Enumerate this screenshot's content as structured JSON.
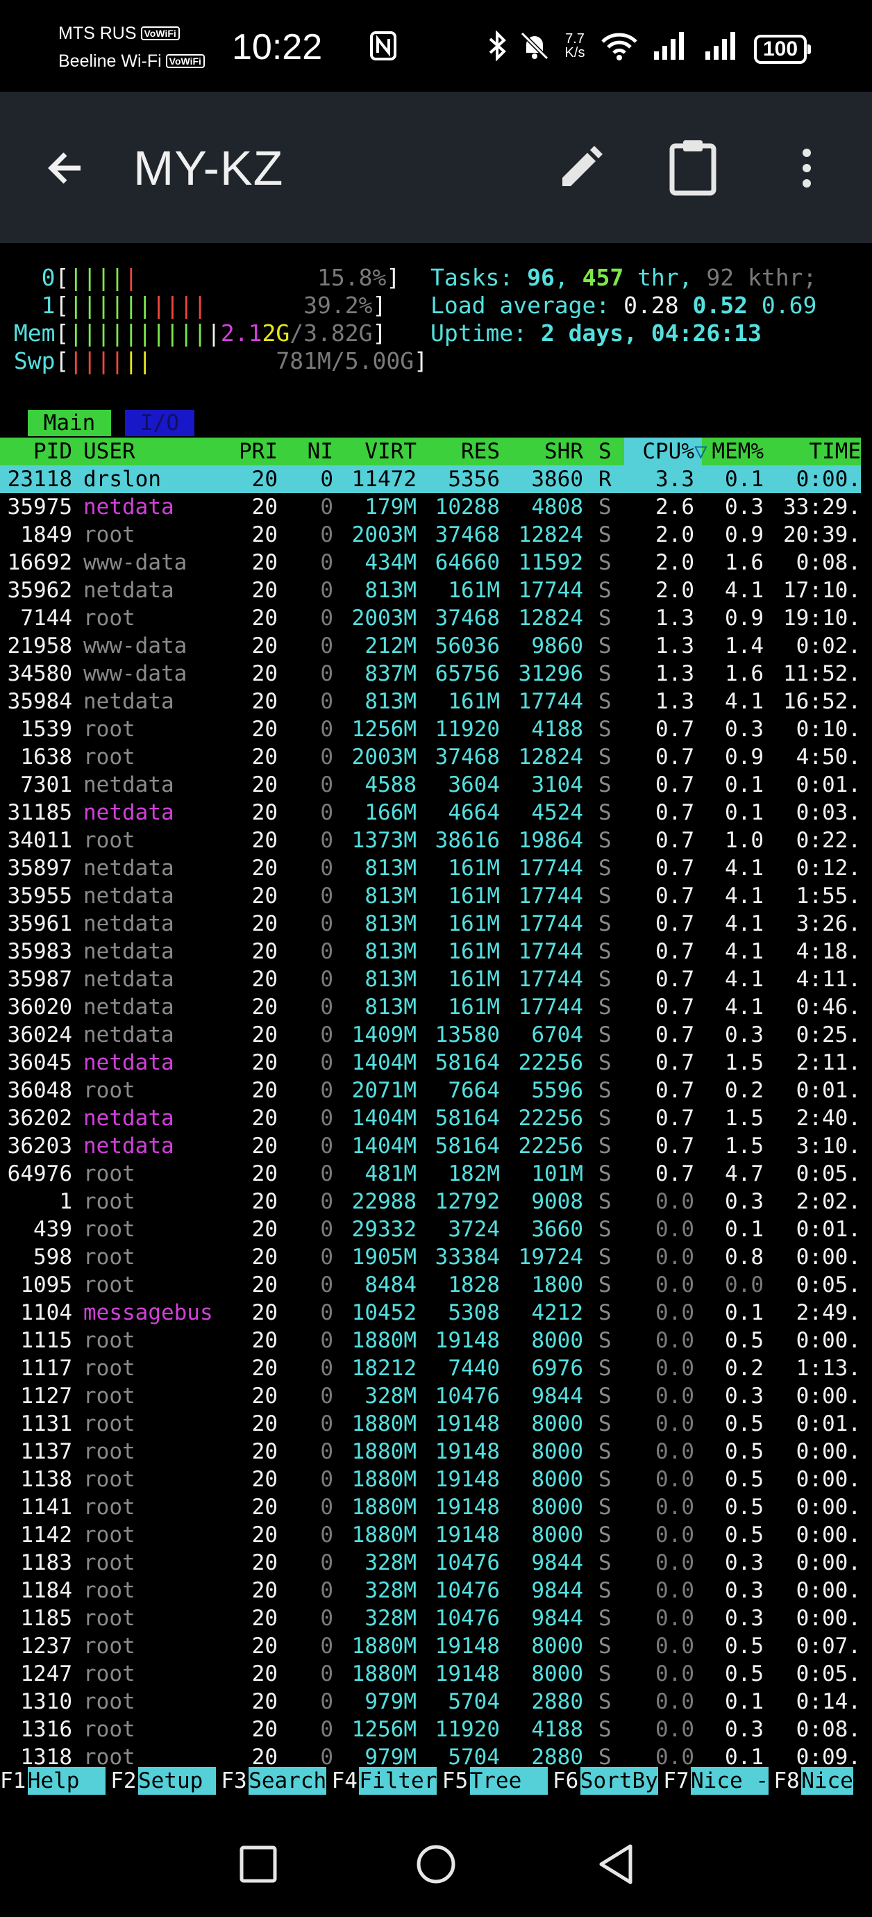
{
  "status_bar": {
    "carrier1": "MTS RUS",
    "carrier1_badge": "VoWiFi",
    "carrier2": "Beeline Wi-Fi",
    "carrier2_badge": "VoWiFi",
    "time": "10:22",
    "net_speed_value": "7.7",
    "net_speed_unit": "K/s",
    "battery": "100",
    "icons": [
      "nfc-icon",
      "bluetooth-icon",
      "mute-bell-icon",
      "wifi-icon",
      "signal-icon",
      "signal-icon",
      "battery-icon"
    ]
  },
  "app_bar": {
    "title": "MY-KZ",
    "icons": [
      "back-arrow-icon",
      "pencil-icon",
      "clipboard-icon",
      "more-vert-icon"
    ]
  },
  "meters": {
    "cpu0": {
      "label": "0",
      "bars": "||||",
      "bars_red": "|",
      "value": "15.8%"
    },
    "cpu1": {
      "label": "1",
      "bars": "||||||",
      "bars_red": "||||",
      "value": "39.2%"
    },
    "mem": {
      "label": "Mem",
      "bars": "||||||||||",
      "value_used_a": "2.1",
      "value_used_b": "2G",
      "value_total": "/3.82G"
    },
    "swp": {
      "label": "Swp",
      "bars_red": "||||",
      "bars_yellow": "||",
      "value": "781M/5.00G"
    }
  },
  "summary": {
    "tasks_label": "Tasks: ",
    "tasks": "96",
    "threads": "457",
    "thr_label": " thr",
    "kthr": "92",
    "kthr_label": " kthr;",
    "load_label": "Load average: ",
    "load1": "0.28",
    "load5": "0.52",
    "load15": "0.69",
    "uptime_label": "Uptime: ",
    "uptime": "2 days, 04:26:13"
  },
  "tabs": [
    {
      "label": "Main"
    },
    {
      "label": "I/O"
    }
  ],
  "columns": {
    "pid": "PID",
    "user": "USER",
    "pri": "PRI",
    "ni": "NI",
    "virt": "VIRT",
    "res": "RES",
    "shr": "SHR",
    "s": "S",
    "cpu": "CPU%",
    "sort_arrow": "▽",
    "mem": "MEM%",
    "time": "TIME"
  },
  "processes": [
    [
      "23118",
      "drslon",
      "20",
      "0",
      "11472",
      "5356",
      "3860",
      "R",
      "3.3",
      "0.1",
      "0:00."
    ],
    [
      "35975",
      "netdata",
      "20",
      "0",
      "179M",
      "10288",
      "4808",
      "S",
      "2.6",
      "0.3",
      "33:29."
    ],
    [
      "1849",
      "root",
      "20",
      "0",
      "2003M",
      "37468",
      "12824",
      "S",
      "2.0",
      "0.9",
      "20:39."
    ],
    [
      "16692",
      "www-data",
      "20",
      "0",
      "434M",
      "64660",
      "11592",
      "S",
      "2.0",
      "1.6",
      "0:08."
    ],
    [
      "35962",
      "netdata",
      "20",
      "0",
      "813M",
      "161M",
      "17744",
      "S",
      "2.0",
      "4.1",
      "17:10."
    ],
    [
      "7144",
      "root",
      "20",
      "0",
      "2003M",
      "37468",
      "12824",
      "S",
      "1.3",
      "0.9",
      "19:10."
    ],
    [
      "21958",
      "www-data",
      "20",
      "0",
      "212M",
      "56036",
      "9860",
      "S",
      "1.3",
      "1.4",
      "0:02."
    ],
    [
      "34580",
      "www-data",
      "20",
      "0",
      "837M",
      "65756",
      "31296",
      "S",
      "1.3",
      "1.6",
      "11:52."
    ],
    [
      "35984",
      "netdata",
      "20",
      "0",
      "813M",
      "161M",
      "17744",
      "S",
      "1.3",
      "4.1",
      "16:52."
    ],
    [
      "1539",
      "root",
      "20",
      "0",
      "1256M",
      "11920",
      "4188",
      "S",
      "0.7",
      "0.3",
      "0:10."
    ],
    [
      "1638",
      "root",
      "20",
      "0",
      "2003M",
      "37468",
      "12824",
      "S",
      "0.7",
      "0.9",
      "4:50."
    ],
    [
      "7301",
      "netdata",
      "20",
      "0",
      "4588",
      "3604",
      "3104",
      "S",
      "0.7",
      "0.1",
      "0:01."
    ],
    [
      "31185",
      "netdata",
      "20",
      "0",
      "166M",
      "4664",
      "4524",
      "S",
      "0.7",
      "0.1",
      "0:03."
    ],
    [
      "34011",
      "root",
      "20",
      "0",
      "1373M",
      "38616",
      "19864",
      "S",
      "0.7",
      "1.0",
      "0:22."
    ],
    [
      "35897",
      "netdata",
      "20",
      "0",
      "813M",
      "161M",
      "17744",
      "S",
      "0.7",
      "4.1",
      "0:12."
    ],
    [
      "35955",
      "netdata",
      "20",
      "0",
      "813M",
      "161M",
      "17744",
      "S",
      "0.7",
      "4.1",
      "1:55."
    ],
    [
      "35961",
      "netdata",
      "20",
      "0",
      "813M",
      "161M",
      "17744",
      "S",
      "0.7",
      "4.1",
      "3:26."
    ],
    [
      "35983",
      "netdata",
      "20",
      "0",
      "813M",
      "161M",
      "17744",
      "S",
      "0.7",
      "4.1",
      "4:18."
    ],
    [
      "35987",
      "netdata",
      "20",
      "0",
      "813M",
      "161M",
      "17744",
      "S",
      "0.7",
      "4.1",
      "4:11."
    ],
    [
      "36020",
      "netdata",
      "20",
      "0",
      "813M",
      "161M",
      "17744",
      "S",
      "0.7",
      "4.1",
      "0:46."
    ],
    [
      "36024",
      "netdata",
      "20",
      "0",
      "1409M",
      "13580",
      "6704",
      "S",
      "0.7",
      "0.3",
      "0:25."
    ],
    [
      "36045",
      "netdata",
      "20",
      "0",
      "1404M",
      "58164",
      "22256",
      "S",
      "0.7",
      "1.5",
      "2:11."
    ],
    [
      "36048",
      "root",
      "20",
      "0",
      "2071M",
      "7664",
      "5596",
      "S",
      "0.7",
      "0.2",
      "0:01."
    ],
    [
      "36202",
      "netdata",
      "20",
      "0",
      "1404M",
      "58164",
      "22256",
      "S",
      "0.7",
      "1.5",
      "2:40."
    ],
    [
      "36203",
      "netdata",
      "20",
      "0",
      "1404M",
      "58164",
      "22256",
      "S",
      "0.7",
      "1.5",
      "3:10."
    ],
    [
      "64976",
      "root",
      "20",
      "0",
      "481M",
      "182M",
      "101M",
      "S",
      "0.7",
      "4.7",
      "0:05."
    ],
    [
      "1",
      "root",
      "20",
      "0",
      "22988",
      "12792",
      "9008",
      "S",
      "0.0",
      "0.3",
      "2:02."
    ],
    [
      "439",
      "root",
      "20",
      "0",
      "29332",
      "3724",
      "3660",
      "S",
      "0.0",
      "0.1",
      "0:01."
    ],
    [
      "598",
      "root",
      "20",
      "0",
      "1905M",
      "33384",
      "19724",
      "S",
      "0.0",
      "0.8",
      "0:00."
    ],
    [
      "1095",
      "root",
      "20",
      "0",
      "8484",
      "1828",
      "1800",
      "S",
      "0.0",
      "0.0",
      "0:05."
    ],
    [
      "1104",
      "messagebus",
      "20",
      "0",
      "10452",
      "5308",
      "4212",
      "S",
      "0.0",
      "0.1",
      "2:49."
    ],
    [
      "1115",
      "root",
      "20",
      "0",
      "1880M",
      "19148",
      "8000",
      "S",
      "0.0",
      "0.5",
      "0:00."
    ],
    [
      "1117",
      "root",
      "20",
      "0",
      "18212",
      "7440",
      "6976",
      "S",
      "0.0",
      "0.2",
      "1:13."
    ],
    [
      "1127",
      "root",
      "20",
      "0",
      "328M",
      "10476",
      "9844",
      "S",
      "0.0",
      "0.3",
      "0:00."
    ],
    [
      "1131",
      "root",
      "20",
      "0",
      "1880M",
      "19148",
      "8000",
      "S",
      "0.0",
      "0.5",
      "0:01."
    ],
    [
      "1137",
      "root",
      "20",
      "0",
      "1880M",
      "19148",
      "8000",
      "S",
      "0.0",
      "0.5",
      "0:00."
    ],
    [
      "1138",
      "root",
      "20",
      "0",
      "1880M",
      "19148",
      "8000",
      "S",
      "0.0",
      "0.5",
      "0:00."
    ],
    [
      "1141",
      "root",
      "20",
      "0",
      "1880M",
      "19148",
      "8000",
      "S",
      "0.0",
      "0.5",
      "0:00."
    ],
    [
      "1142",
      "root",
      "20",
      "0",
      "1880M",
      "19148",
      "8000",
      "S",
      "0.0",
      "0.5",
      "0:00."
    ],
    [
      "1183",
      "root",
      "20",
      "0",
      "328M",
      "10476",
      "9844",
      "S",
      "0.0",
      "0.3",
      "0:00."
    ],
    [
      "1184",
      "root",
      "20",
      "0",
      "328M",
      "10476",
      "9844",
      "S",
      "0.0",
      "0.3",
      "0:00."
    ],
    [
      "1185",
      "root",
      "20",
      "0",
      "328M",
      "10476",
      "9844",
      "S",
      "0.0",
      "0.3",
      "0:00."
    ],
    [
      "1237",
      "root",
      "20",
      "0",
      "1880M",
      "19148",
      "8000",
      "S",
      "0.0",
      "0.5",
      "0:07."
    ],
    [
      "1247",
      "root",
      "20",
      "0",
      "1880M",
      "19148",
      "8000",
      "S",
      "0.0",
      "0.5",
      "0:05."
    ],
    [
      "1310",
      "root",
      "20",
      "0",
      "979M",
      "5704",
      "2880",
      "S",
      "0.0",
      "0.1",
      "0:14."
    ],
    [
      "1316",
      "root",
      "20",
      "0",
      "1256M",
      "11920",
      "4188",
      "S",
      "0.0",
      "0.3",
      "0:08."
    ],
    [
      "1318",
      "root",
      "20",
      "0",
      "979M",
      "5704",
      "2880",
      "S",
      "0.0",
      "0.1",
      "0:09."
    ]
  ],
  "function_keys": [
    {
      "key": "F1",
      "label": "Help  "
    },
    {
      "key": "F2",
      "label": "Setup "
    },
    {
      "key": "F3",
      "label": "Search"
    },
    {
      "key": "F4",
      "label": "Filter"
    },
    {
      "key": "F5",
      "label": "Tree  "
    },
    {
      "key": "F6",
      "label": "SortBy"
    },
    {
      "key": "F7",
      "label": "Nice -"
    },
    {
      "key": "F8",
      "label": "Nice"
    }
  ],
  "colors": {
    "cyan": "#55e0e0",
    "green": "#3cd03c",
    "magenta": "#d040d8",
    "red": "#f0463c",
    "yellow": "#e6e620",
    "dim": "#7a7a7a",
    "appbar": "#20252b"
  }
}
